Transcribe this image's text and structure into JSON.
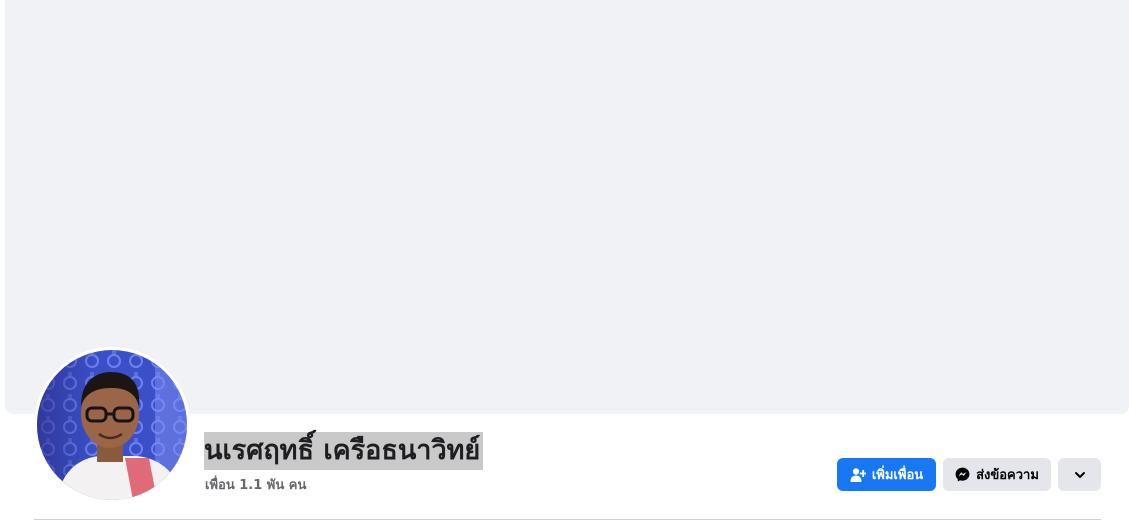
{
  "profile": {
    "name": "นเรศฤทธิ์ เครือธนาวิทย์",
    "friends_count": "เพื่อน 1.1 พัน คน"
  },
  "actions": {
    "add_friend_label": "เพิ่มเพื่อน",
    "add_friend_icon": "person-add-icon",
    "message_label": "ส่งข้อความ",
    "message_icon": "messenger-icon",
    "more_icon": "chevron-down-icon"
  },
  "colors": {
    "primary_button": "#1877f2",
    "secondary_button": "#e4e6eb",
    "cover_background": "#f0f2f5",
    "name_highlight": "#c9c9c9"
  }
}
